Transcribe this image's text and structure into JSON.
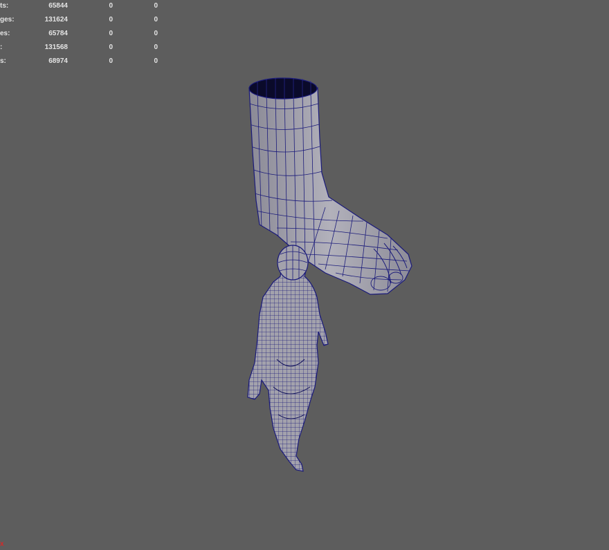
{
  "hud": {
    "rows": [
      {
        "label": "ts:",
        "value": "65844",
        "selected": "0",
        "triangles": "0"
      },
      {
        "label": "ges:",
        "value": "131624",
        "selected": "0",
        "triangles": "0"
      },
      {
        "label": "es:",
        "value": "65784",
        "selected": "0",
        "triangles": "0"
      },
      {
        "label": ":",
        "value": "131568",
        "selected": "0",
        "triangles": "0"
      },
      {
        "label": "s:",
        "value": "68974",
        "selected": "0",
        "triangles": "0"
      }
    ]
  },
  "axis": {
    "label": "x",
    "color": "#d62828"
  },
  "colors": {
    "background": "#5d5d5d",
    "mesh_fill": "#a3a2ac",
    "wire": "#1a1a7a",
    "opening": "#0a0a2a"
  },
  "objects": [
    "foot-model",
    "female-figure-model"
  ]
}
